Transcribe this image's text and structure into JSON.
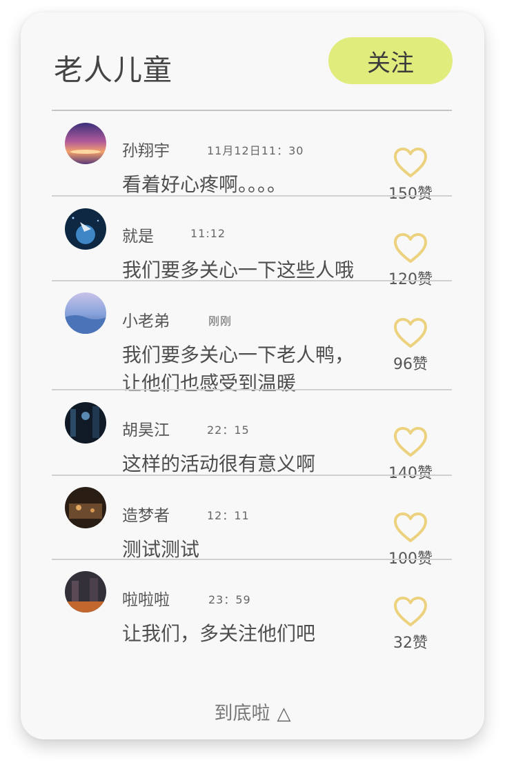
{
  "header": {
    "title": "老人儿童",
    "follow_label": "关注"
  },
  "comments": [
    {
      "user": "孙翔宇",
      "time": "11月12日11：30",
      "text": "看着好心疼啊。。。。",
      "likes": "150赞"
    },
    {
      "user": "就是",
      "time": "11:12",
      "text": "我们要多关心一下这些人哦",
      "likes": "120赞"
    },
    {
      "user": "小老弟",
      "time": "刚刚",
      "text_lines": [
        "我们要多关心一下老人鸭，",
        "让他们也感受到温暖"
      ],
      "likes": "96赞"
    },
    {
      "user": "胡昊江",
      "time": "22：15",
      "text": "这样的活动很有意义啊",
      "likes": "140赞"
    },
    {
      "user": "造梦者",
      "time": "12：11",
      "text": "测试测试",
      "likes": "100赞"
    },
    {
      "user": "啦啦啦",
      "time": "23：59",
      "text": "让我们，多关注他们吧",
      "likes": "32赞"
    }
  ],
  "footer": {
    "end_text": "到底啦",
    "icon": "triangle-up-icon"
  },
  "colors": {
    "accent": "#e0ec7c",
    "heart": "#ecd27e"
  }
}
